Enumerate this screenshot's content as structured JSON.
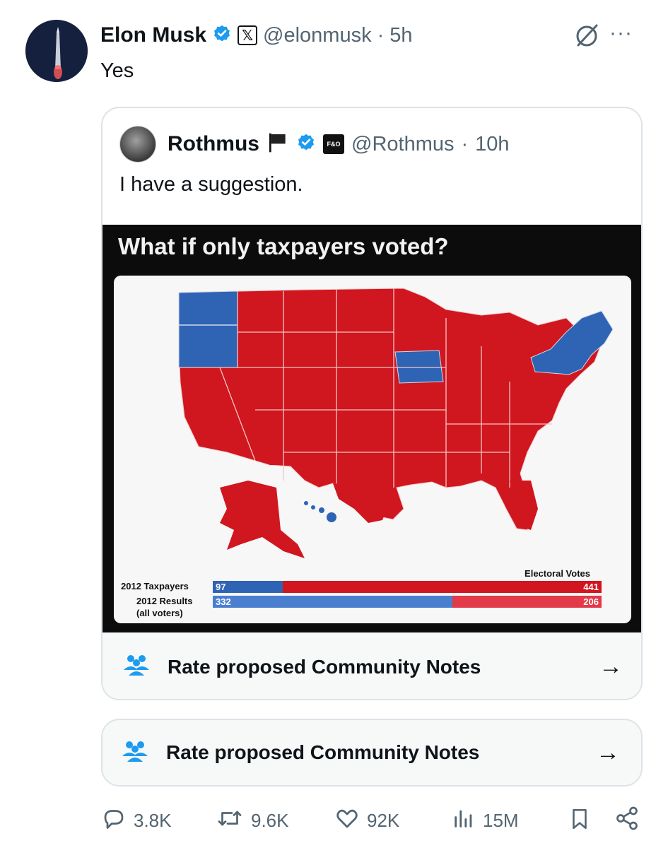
{
  "tweet": {
    "author_name": "Elon Musk",
    "handle": "@elonmusk",
    "time": "5h",
    "text": "Yes",
    "more_label": "···"
  },
  "quote": {
    "author_name": "Rothmus",
    "handle": "@Rothmus",
    "time": "10h",
    "text": "I have a suggestion.",
    "media": {
      "title": "What if only taxpayers voted?",
      "electoral_votes_label": "Electoral Votes",
      "rows": [
        {
          "label": "2012 Taxpayers",
          "blue": "97",
          "red": "441"
        },
        {
          "label": "2012 Results",
          "sublabel": "(all voters)",
          "blue": "332",
          "red": "206"
        }
      ]
    }
  },
  "community_notes": {
    "label": "Rate proposed Community Notes",
    "arrow": "→"
  },
  "actions": {
    "replies": "3.8K",
    "reposts": "9.6K",
    "likes": "92K",
    "views": "15M"
  },
  "colors": {
    "verified": "#1d9bf0",
    "map_red": "#d0161e",
    "map_blue": "#2f63b4",
    "muted_text": "#536471"
  }
}
